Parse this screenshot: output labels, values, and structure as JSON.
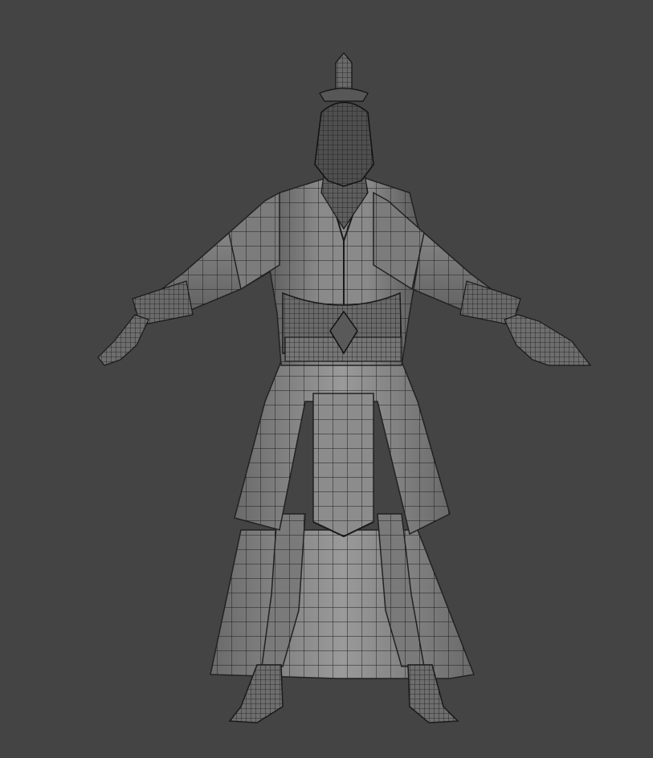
{
  "viewport": {
    "background_color": "#444444",
    "shading_mode": "shaded-with-wireframe",
    "subject": "character-model",
    "pose": "t-pose",
    "mesh_color_light": "#8e8e8e",
    "mesh_color_dark": "#3a3a3a",
    "wire_color": "#1e1e1e"
  }
}
